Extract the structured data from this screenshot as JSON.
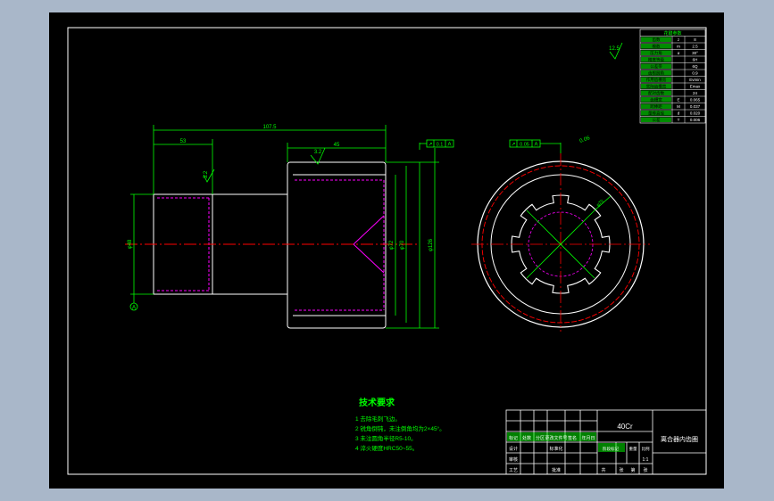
{
  "drawing": {
    "dims": {
      "overall_length": "107.5",
      "left_length": "53",
      "right_length": "45",
      "left_dia": "φ48",
      "inner_dia": "φ72",
      "spline_dia": "φ70",
      "outer_dia": "φ126",
      "datum_label": "A"
    },
    "roughness": {
      "corner": "12.5",
      "left": "3.2",
      "bore": "3.2"
    },
    "tolerance_left": [
      "↗",
      "0.1",
      "A"
    ],
    "tolerance_right": [
      "↗",
      "0.05",
      "A"
    ],
    "tolerance_note": "0.06"
  },
  "param_table": {
    "header": "花键参数",
    "rows": [
      [
        "齿数",
        "z",
        "8"
      ],
      [
        "模数",
        "m",
        "2.5"
      ],
      [
        "压力角",
        "α",
        "30°"
      ],
      [
        "精度等级",
        "",
        "6H"
      ],
      [
        "公差带",
        "",
        "6Q"
      ],
      [
        "齿根圆角",
        "",
        "0.9"
      ],
      [
        "作用齿槽宽",
        "",
        "Evmin"
      ],
      [
        "实际齿槽宽",
        "",
        "Emax"
      ],
      [
        "配对齿数",
        "",
        "24"
      ],
      [
        "齿槽宽",
        "E",
        "0.065"
      ],
      [
        "跨棒距",
        "M",
        "0.037"
      ],
      [
        "量棒直径",
        "d",
        "0.020"
      ],
      [
        "公差",
        "T",
        "0.006"
      ]
    ]
  },
  "tech_req": {
    "title": "技术要求",
    "items": [
      "1 去除毛刺飞边。",
      "2 锐角倒钝，未注倒角均为2×45°。",
      "3 未注圆角半径R5-10。",
      "4 淬火硬度HRC50~55。"
    ]
  },
  "title_block": {
    "material": "40Cr",
    "part_name": "离合器内齿圈",
    "left_cells": [
      "标记",
      "处数",
      "分区",
      "更改文件号",
      "签名",
      "年月日"
    ],
    "row2": [
      "设计",
      "",
      "标准化",
      "",
      "阶段标记",
      "重量",
      "比例"
    ],
    "scale": "1:1",
    "row3": [
      "审核",
      "",
      "",
      ""
    ],
    "row4": [
      "工艺",
      "",
      "批准",
      "",
      "共",
      "张",
      "第",
      "张"
    ]
  },
  "colors": {
    "background": "#000000",
    "frame": "#ffffff",
    "dimension": "#00ff00",
    "centerline": "#ff0000",
    "hidden": "#ff00ff",
    "outline": "#ffffff"
  }
}
